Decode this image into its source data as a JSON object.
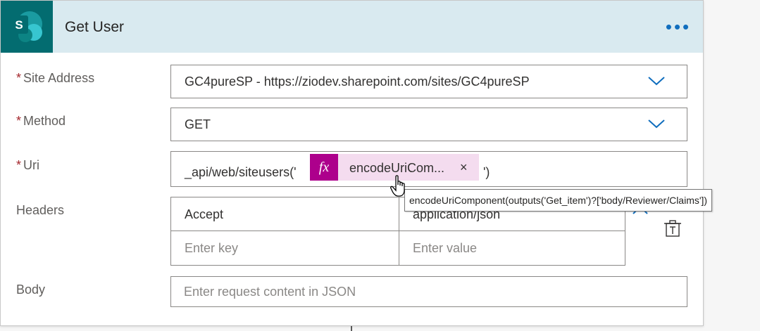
{
  "action": {
    "title": "Get User",
    "logo_letter": "S",
    "menu_icon": "more-horizontal-icon",
    "accent": "#036c70"
  },
  "fields": {
    "site_address": {
      "label": "Site Address",
      "required_mark": "*",
      "value": "GC4pureSP - https://ziodev.sharepoint.com/sites/GC4pureSP"
    },
    "method": {
      "label": "Method",
      "required_mark": "*",
      "value": "GET"
    },
    "uri": {
      "label": "Uri",
      "required_mark": "*",
      "prefix": "_api/web/siteusers('",
      "token_text": "encodeUriCom...",
      "token_close": "×",
      "suffix": "')",
      "tooltip": "encodeUriComponent(outputs('Get_item')?['body/Reviewer/Claims'])"
    },
    "headers": {
      "label": "Headers",
      "rows": [
        {
          "key": "Accept",
          "value": "application/json"
        }
      ],
      "key_placeholder": "Enter key",
      "value_placeholder": "Enter value"
    },
    "body": {
      "label": "Body",
      "placeholder": "Enter request content in JSON"
    }
  },
  "colors": {
    "header_bg": "#d9eaf0",
    "token_bg": "#f4dcef",
    "token_fx": "#ad008c",
    "required": "#a4262c",
    "link": "#106ebe"
  }
}
